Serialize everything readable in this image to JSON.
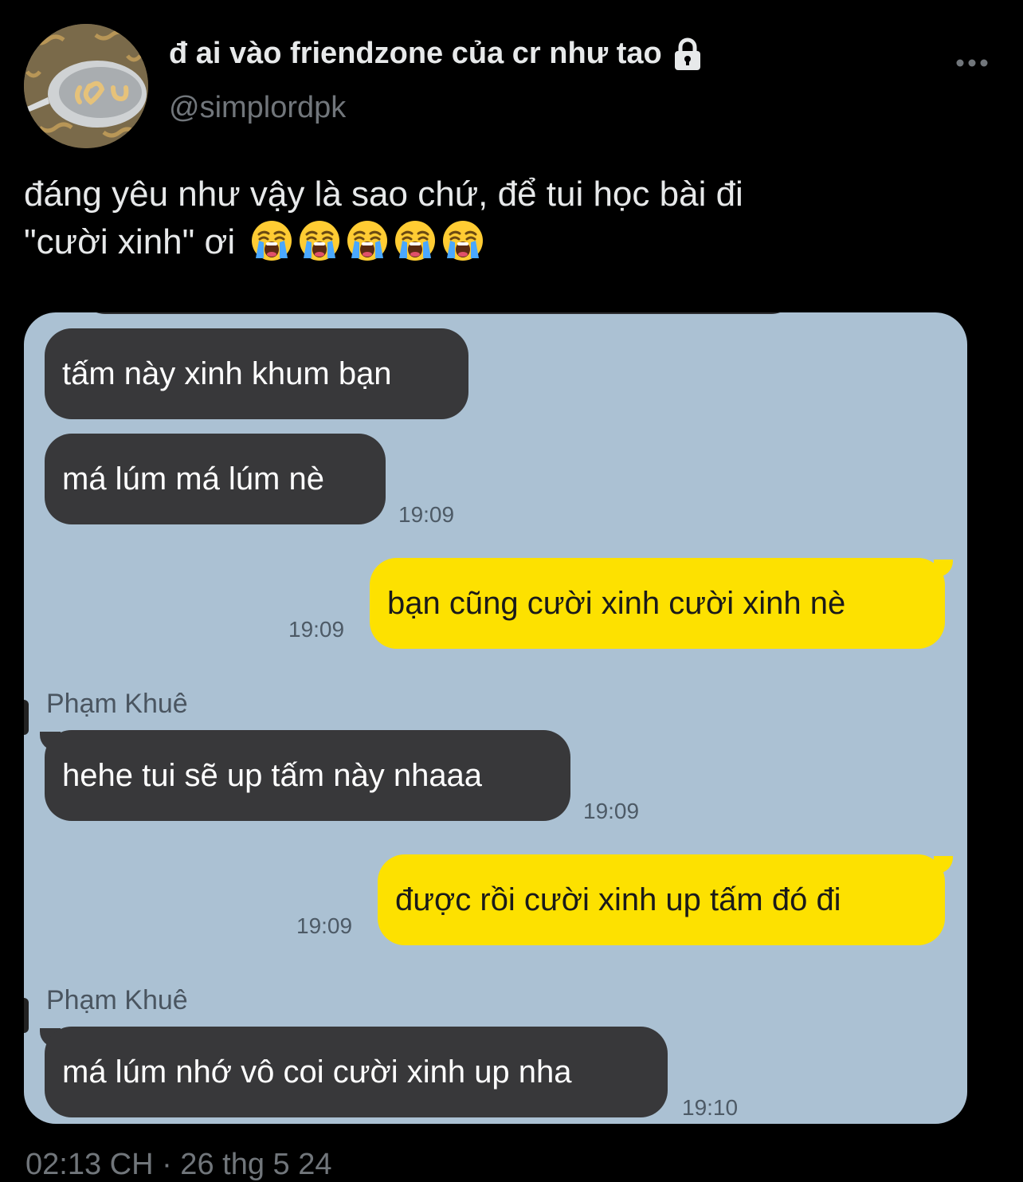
{
  "tweet": {
    "display_name": "đ ai vào friendzone của cr như tao",
    "handle": "@simplordpk",
    "text_line1": "đáng yêu như vậy là sao chứ, để tui học bài đi",
    "text_line2": "\"cười xinh\" ơi",
    "emoji_count": 5,
    "emoji_name": "loudly-crying-face",
    "timestamp": "02:13 CH · 26 thg 5 24"
  },
  "chat": {
    "messages": [
      {
        "direction": "in",
        "text": "tấm này xinh khum bạn"
      },
      {
        "direction": "in",
        "text": "má lúm má lúm nè",
        "time": "19:09"
      },
      {
        "direction": "out",
        "text": "bạn cũng cười xinh cười xinh nè",
        "time": "19:09"
      },
      {
        "direction": "in",
        "sender": "Phạm Khuê",
        "text": "hehe tui sẽ up tấm này nhaaa",
        "time": "19:09"
      },
      {
        "direction": "out",
        "text": "được rồi cười xinh up tấm đó đi",
        "time": "19:09"
      },
      {
        "direction": "in",
        "sender": "Phạm Khuê",
        "text": "má lúm nhớ vô coi cười xinh up nha",
        "time": "19:10"
      }
    ]
  },
  "colors": {
    "background": "#000000",
    "chat_background": "#abc1d3",
    "incoming_bubble": "#38383a",
    "outgoing_bubble": "#fde100",
    "muted_text": "#71767b"
  },
  "icons": {
    "lock": "lock-icon",
    "more": "more-horizontal-icon",
    "emoji": "loudly-crying-face-icon"
  }
}
